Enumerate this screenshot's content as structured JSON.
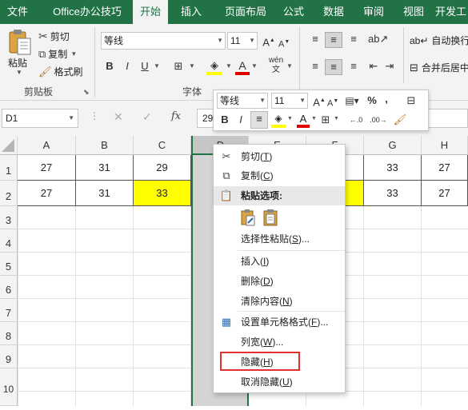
{
  "ribbon_tabs": [
    "文件",
    "Office办公技巧",
    "开始",
    "插入",
    "页面布局",
    "公式",
    "数据",
    "审阅",
    "视图",
    "开发工"
  ],
  "ribbon": {
    "paste_label": "粘贴",
    "cut_label": "剪切",
    "copy_label": "复制",
    "format_painter_label": "格式刷",
    "clipboard_group": "剪贴板",
    "font_name": "等线",
    "font_size": "11",
    "font_group": "字体",
    "bold": "B",
    "italic": "I",
    "underline": "U",
    "wrap_text_label": "自动换行",
    "merge_label": "合并后居中"
  },
  "formula_bar": {
    "name_box": "D1",
    "formula_value": "29",
    "fx_label": "fx"
  },
  "mini_toolbar": {
    "font_name": "等线",
    "font_size": "11",
    "percent": "%",
    "comma": ",",
    "bold": "B",
    "italic": "I"
  },
  "grid": {
    "columns": [
      "A",
      "B",
      "C",
      "D",
      "E",
      "F",
      "G",
      "H"
    ],
    "rows": [
      "1",
      "2",
      "3",
      "4",
      "5",
      "6",
      "7",
      "8",
      "9",
      "10"
    ],
    "row1": [
      "27",
      "31",
      "29",
      "",
      "",
      "",
      "33",
      "27"
    ],
    "row2": [
      "27",
      "31",
      "33",
      "",
      "",
      "",
      "33",
      "27"
    ]
  },
  "context_menu": {
    "cut": {
      "label": "剪切(",
      "key": "T",
      "end": ")"
    },
    "copy": {
      "label": "复制(",
      "key": "C",
      "end": ")"
    },
    "paste_options": "粘贴选项:",
    "paste_special": {
      "label": "选择性粘贴(",
      "key": "S",
      "end": ")..."
    },
    "insert": {
      "label": "插入(",
      "key": "I",
      "end": ")"
    },
    "delete": {
      "label": "删除(",
      "key": "D",
      "end": ")"
    },
    "clear_contents": {
      "label": "清除内容(",
      "key": "N",
      "end": ")"
    },
    "format_cells": {
      "label": "设置单元格格式(",
      "key": "F",
      "end": ")..."
    },
    "column_width": {
      "label": "列宽(",
      "key": "W",
      "end": ")..."
    },
    "hide": {
      "label": "隐藏(",
      "key": "H",
      "end": ")"
    },
    "unhide": {
      "label": "取消隐藏(",
      "key": "U",
      "end": ")"
    }
  },
  "colors": {
    "excel_green": "#217346",
    "highlight_yellow": "#ffff00",
    "hide_box_red": "#e03030",
    "font_color_red": "#e00000"
  }
}
